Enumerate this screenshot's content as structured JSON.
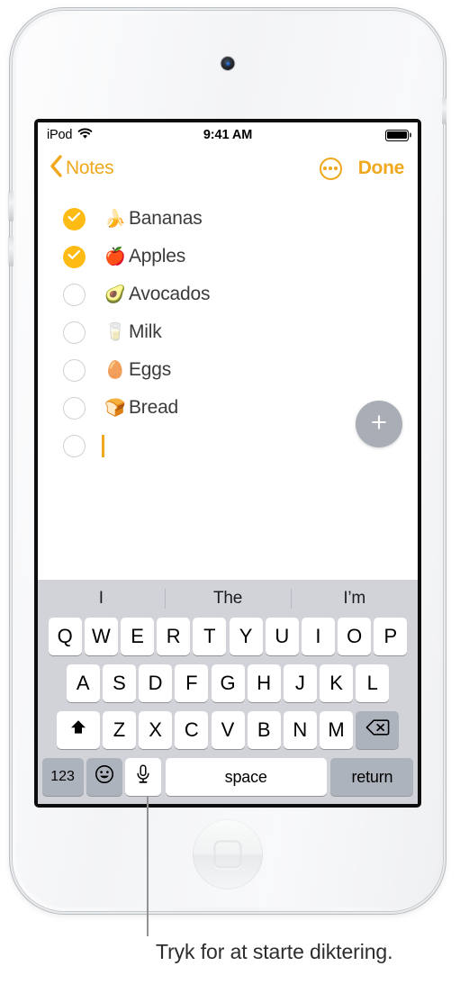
{
  "device": {
    "name": "ipod-touch",
    "camera_icon": "front-camera",
    "home_button_icon": "home-button"
  },
  "status_bar": {
    "carrier": "iPod",
    "wifi_icon": "wifi-icon",
    "time": "9:41 AM",
    "battery_icon": "battery-full-icon",
    "battery_level": 100
  },
  "nav_bar": {
    "back_icon": "chevron-left-icon",
    "back_label": "Notes",
    "more_icon": "more-circle-icon",
    "done_label": "Done",
    "accent_color": "#f0a81e"
  },
  "note": {
    "items": [
      {
        "label": "Bananas",
        "emoji": "🍌",
        "checked": true
      },
      {
        "label": "Apples",
        "emoji": "🍎",
        "checked": true
      },
      {
        "label": "Avocados",
        "emoji": "🥑",
        "checked": false
      },
      {
        "label": "Milk",
        "emoji": "🥛",
        "checked": false
      },
      {
        "label": "Eggs",
        "emoji": "🥚",
        "checked": false
      },
      {
        "label": "Bread",
        "emoji": "🍞",
        "checked": false
      }
    ],
    "empty_row": {
      "label": "",
      "emoji": "",
      "checked": false,
      "has_caret": true
    },
    "add_button_icon": "plus-icon",
    "checked_color": "#fdbb13",
    "caret_color": "#f0a81e"
  },
  "keyboard": {
    "suggestions": [
      "I",
      "The",
      "I’m"
    ],
    "row1": [
      "Q",
      "W",
      "E",
      "R",
      "T",
      "Y",
      "U",
      "I",
      "O",
      "P"
    ],
    "row2": [
      "A",
      "S",
      "D",
      "F",
      "G",
      "H",
      "J",
      "K",
      "L"
    ],
    "row3": [
      "Z",
      "X",
      "C",
      "V",
      "B",
      "N",
      "M"
    ],
    "shift_icon": "shift-up-arrow-icon",
    "backspace_icon": "backspace-delete-icon",
    "numbers_label": "123",
    "emoji_icon": "smiley-face-icon",
    "mic_icon": "microphone-icon",
    "space_label": "space",
    "return_label": "return",
    "background_color": "#d1d3d9",
    "key_color": "#ffffff",
    "function_key_color": "#adb3bd"
  },
  "callout": {
    "caption": "Tryk for at starte diktering.",
    "target": "mic-key",
    "line_color": "#939393"
  }
}
